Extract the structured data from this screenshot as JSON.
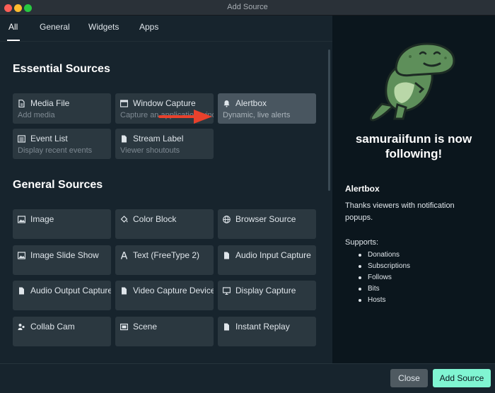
{
  "window": {
    "title": "Add Source"
  },
  "tabs": [
    {
      "label": "All",
      "active": true
    },
    {
      "label": "General",
      "active": false
    },
    {
      "label": "Widgets",
      "active": false
    },
    {
      "label": "Apps",
      "active": false
    }
  ],
  "essential": {
    "title": "Essential Sources",
    "cards": [
      {
        "label": "Media File",
        "desc": "Add media",
        "icon": "file-icon"
      },
      {
        "label": "Window Capture",
        "desc": "Capture an application window",
        "icon": "window-icon"
      },
      {
        "label": "Alertbox",
        "desc": "Dynamic, live alerts",
        "icon": "bell-icon",
        "selected": true
      },
      {
        "label": "Event List",
        "desc": "Display recent events",
        "icon": "list-icon"
      },
      {
        "label": "Stream Label",
        "desc": "Viewer shoutouts",
        "icon": "file-icon"
      }
    ]
  },
  "general": {
    "title": "General Sources",
    "cards": [
      {
        "label": "Image",
        "icon": "image-icon"
      },
      {
        "label": "Color Block",
        "icon": "paint-bucket-icon"
      },
      {
        "label": "Browser Source",
        "icon": "globe-icon"
      },
      {
        "label": "Image Slide Show",
        "icon": "image-icon"
      },
      {
        "label": "Text (FreeType 2)",
        "icon": "text-icon"
      },
      {
        "label": "Audio Input Capture",
        "icon": "file-icon"
      },
      {
        "label": "Audio Output Capture",
        "icon": "file-icon"
      },
      {
        "label": "Video Capture Device",
        "icon": "file-icon"
      },
      {
        "label": "Display Capture",
        "icon": "monitor-icon"
      },
      {
        "label": "Collab Cam",
        "icon": "users-icon"
      },
      {
        "label": "Scene",
        "icon": "scene-icon"
      },
      {
        "label": "Instant Replay",
        "icon": "file-icon"
      }
    ]
  },
  "preview": {
    "promo_title_line1": "samuraiifunn is now",
    "promo_title_line2": "following!",
    "heading": "Alertbox",
    "description": "Thanks viewers with notification popups.",
    "supports_label": "Supports:",
    "supports": [
      "Donations",
      "Subscriptions",
      "Follows",
      "Bits",
      "Hosts"
    ]
  },
  "footer": {
    "close_label": "Close",
    "add_label": "Add Source"
  },
  "colors": {
    "accent": "#80f5d2",
    "annotation_arrow": "#e8412c",
    "dino_green": "#5e8f5a"
  }
}
